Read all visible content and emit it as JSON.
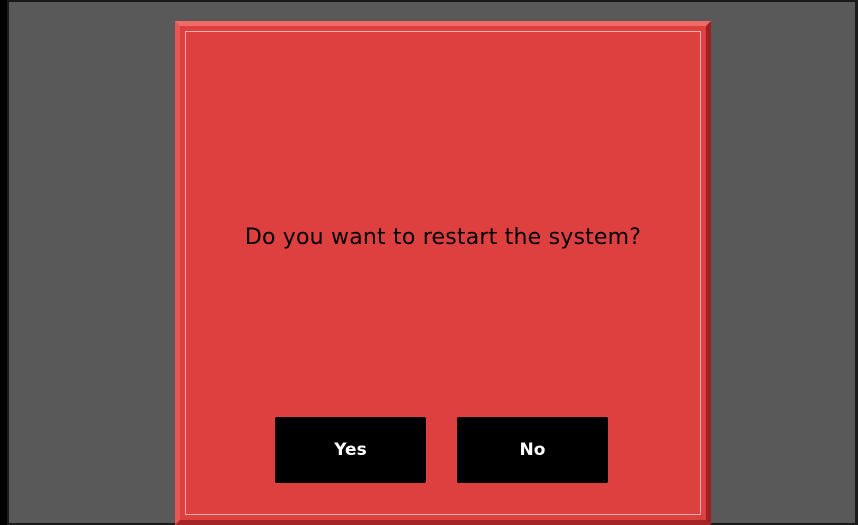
{
  "dialog": {
    "message": "Do you want to restart the system?",
    "yes_label": "Yes",
    "no_label": "No"
  },
  "colors": {
    "background": "#595959",
    "dialog": "#de3f3f",
    "button": "#000000"
  }
}
